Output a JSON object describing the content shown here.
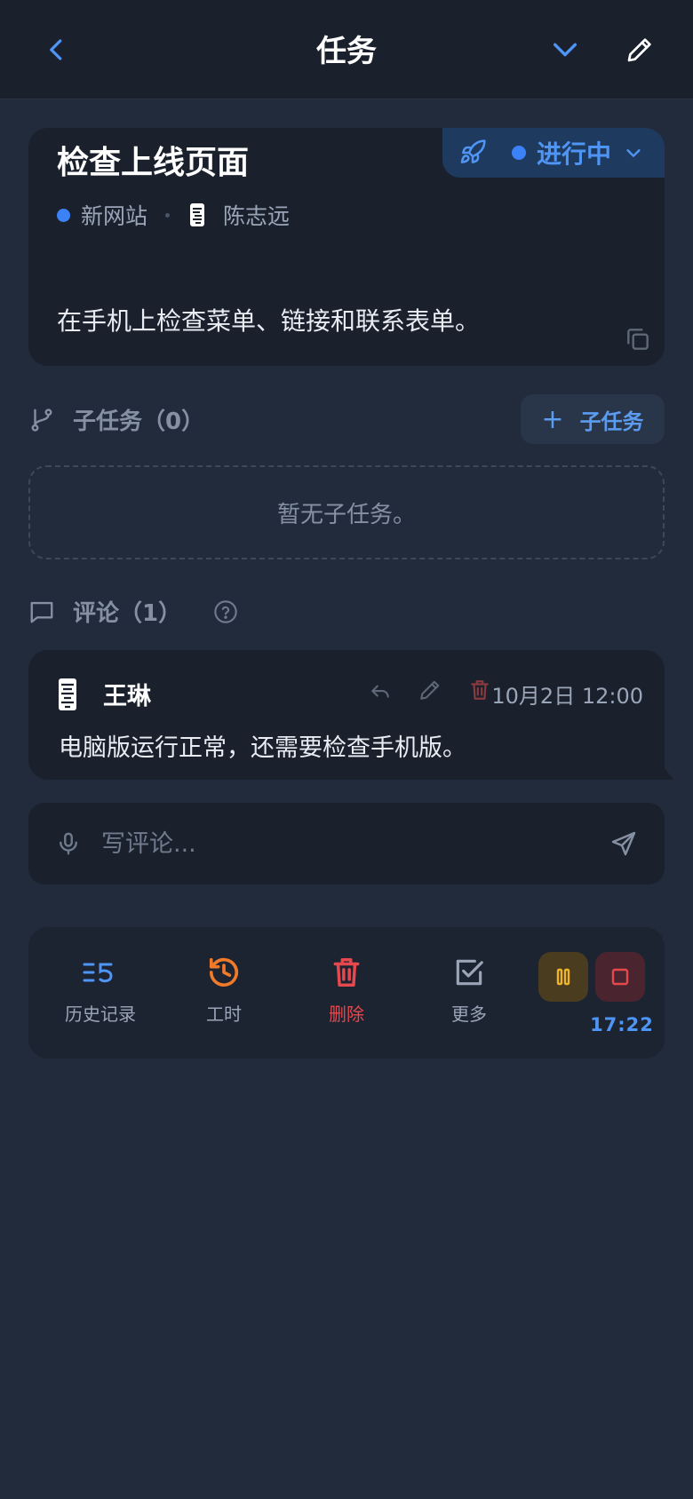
{
  "header": {
    "title": "任务"
  },
  "task": {
    "title": "检查上线页面",
    "status": "进行中",
    "project": "新网站",
    "assignee": "陈志远",
    "description": "在手机上检查菜单、链接和联系表单。"
  },
  "subtasks": {
    "label": "子任务（0）",
    "add_label": "子任务",
    "empty_text": "暂无子任务。"
  },
  "comments": {
    "label": "评论（1）",
    "items": [
      {
        "author": "王琳",
        "time": "10月2日 12:00",
        "text": "电脑版运行正常，还需要检查手机版。"
      }
    ],
    "input_placeholder": "写评论..."
  },
  "toolbar": {
    "history": "历史记录",
    "worktime": "工时",
    "delete": "删除",
    "more": "更多",
    "timer": "17:22"
  },
  "colors": {
    "accent": "#4f95f5",
    "worktime": "#f07a2a",
    "danger": "#e5484d",
    "pause": "#f0b429",
    "background": "#212b3b",
    "card": "#1a212d"
  },
  "icons": {
    "back": "chevron-left-icon",
    "collapse": "chevron-down-icon",
    "edit": "pencil-icon",
    "status": "rocket-icon",
    "copy": "copy-icon",
    "subtasks": "git-branch-icon",
    "comments": "message-square-icon",
    "help": "help-circle-icon",
    "reply": "reply-icon",
    "mic": "microphone-icon",
    "send": "send-icon",
    "history": "history-list-icon",
    "worktime": "clock-history-icon",
    "delete": "trash-icon",
    "more": "checkbox-icon",
    "pause": "pause-icon",
    "stop": "stop-icon"
  }
}
